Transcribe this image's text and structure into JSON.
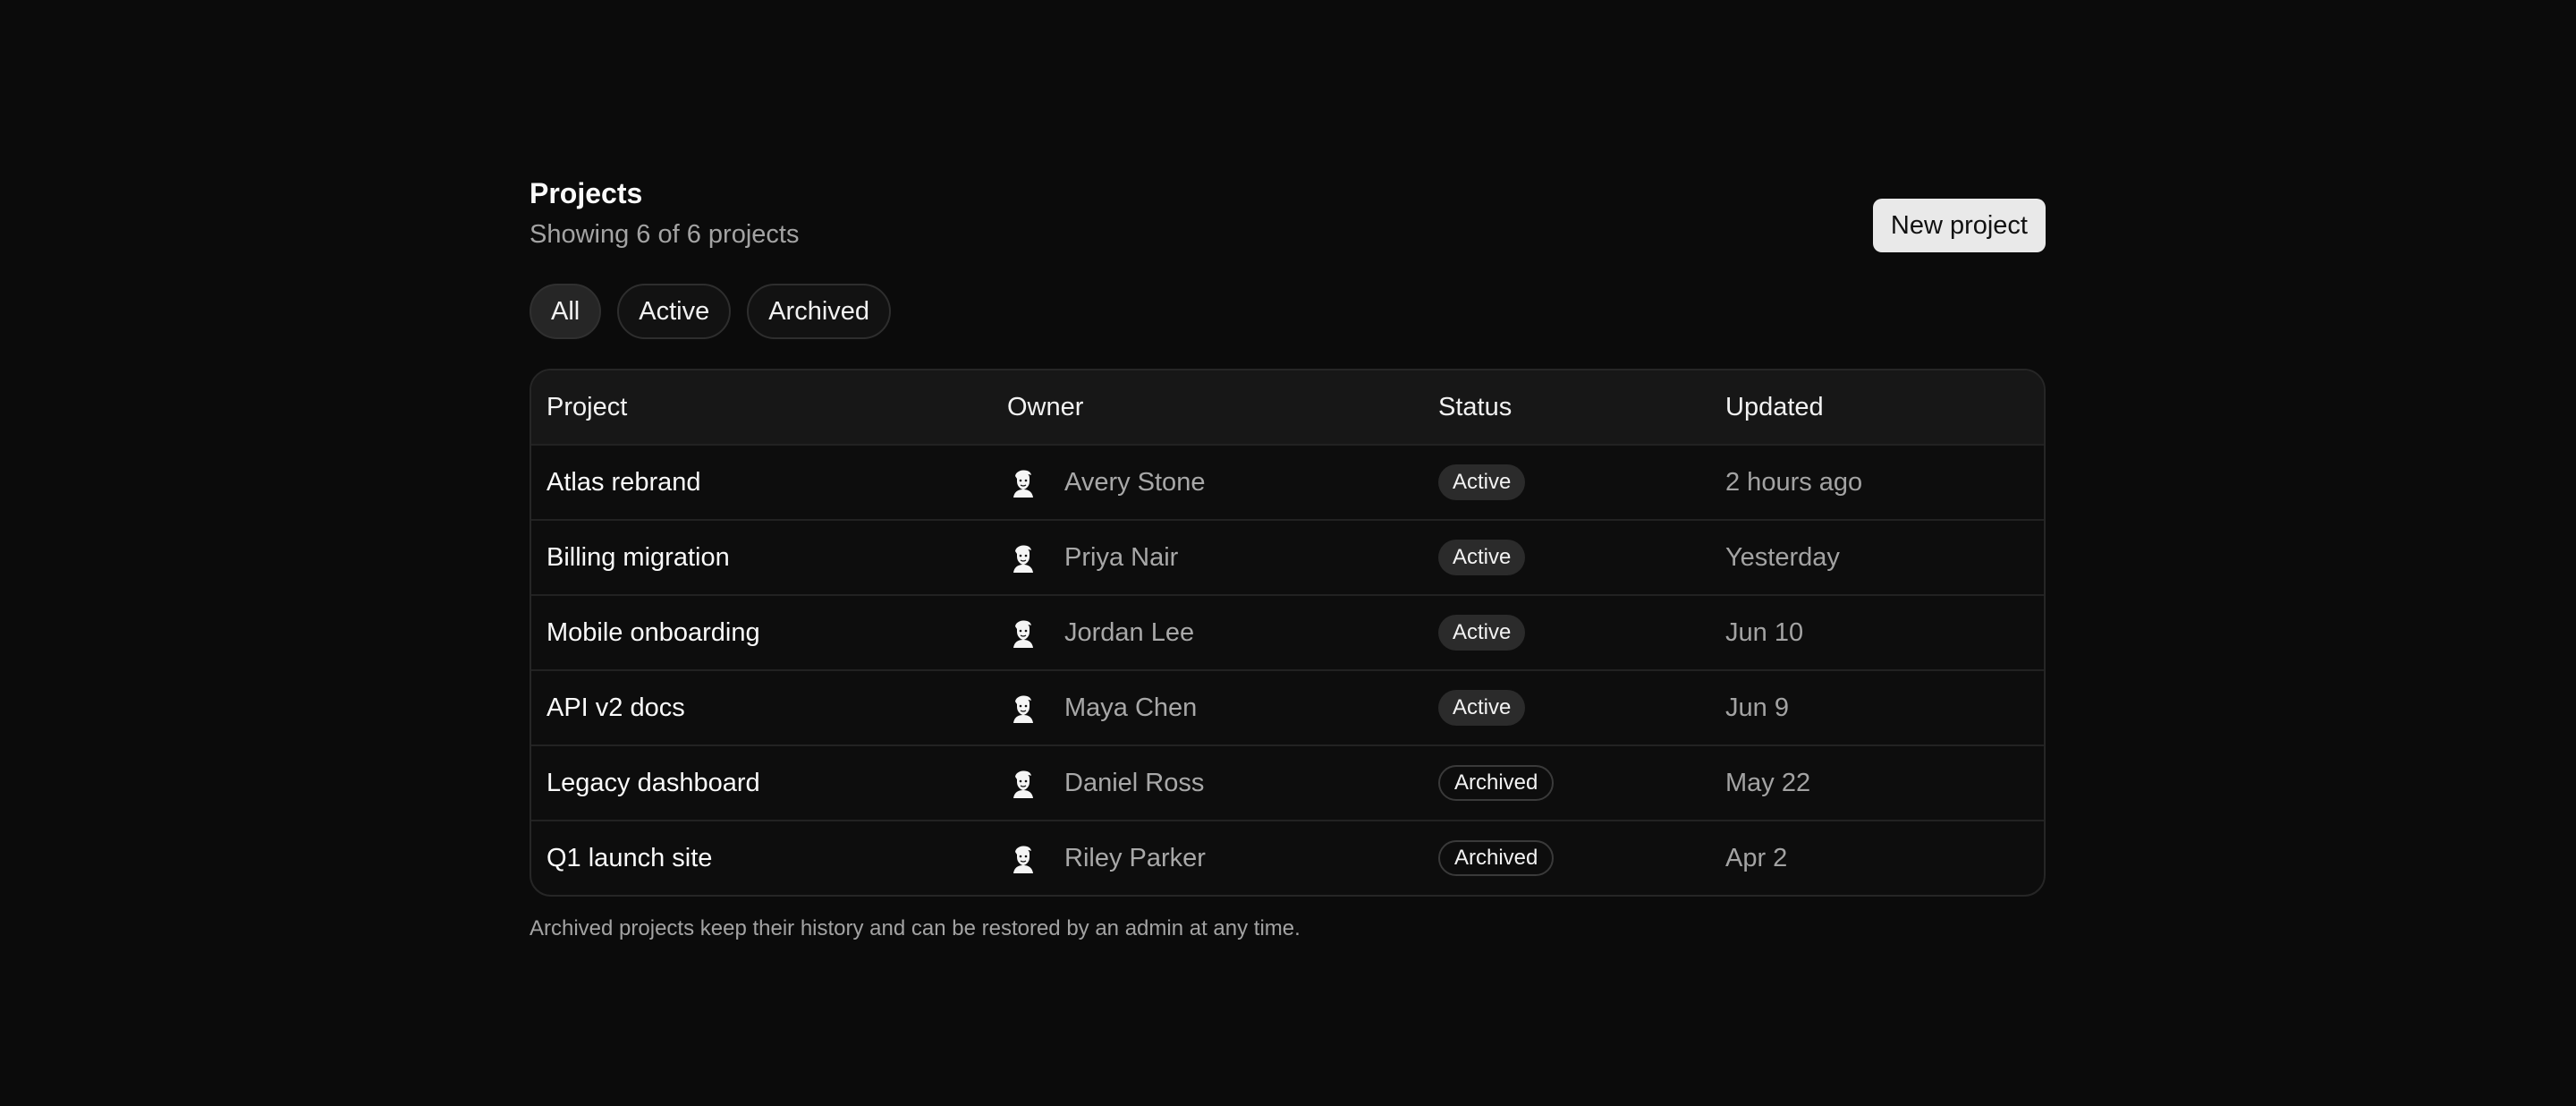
{
  "header": {
    "title": "Projects",
    "subtitle": "Showing 6 of 6 projects",
    "new_button": "New project"
  },
  "filters": [
    {
      "label": "All",
      "selected": true
    },
    {
      "label": "Active",
      "selected": false
    },
    {
      "label": "Archived",
      "selected": false
    }
  ],
  "table": {
    "columns": [
      "Project",
      "Owner",
      "Status",
      "Updated"
    ],
    "rows": [
      {
        "project": "Atlas rebrand",
        "owner": "Avery Stone",
        "status": "Active",
        "updated": "2 hours ago"
      },
      {
        "project": "Billing migration",
        "owner": "Priya Nair",
        "status": "Active",
        "updated": "Yesterday"
      },
      {
        "project": "Mobile onboarding",
        "owner": "Jordan Lee",
        "status": "Active",
        "updated": "Jun 10"
      },
      {
        "project": "API v2 docs",
        "owner": "Maya Chen",
        "status": "Active",
        "updated": "Jun 9"
      },
      {
        "project": "Legacy dashboard",
        "owner": "Daniel Ross",
        "status": "Archived",
        "updated": "May 22"
      },
      {
        "project": "Q1 launch site",
        "owner": "Riley Parker",
        "status": "Archived",
        "updated": "Apr 2"
      }
    ]
  },
  "footnote": "Archived projects keep their history and can be restored by an admin at any time.",
  "icons": {
    "avatar": "avatar-illustration-icon"
  },
  "colors": {
    "background": "#0b0b0b",
    "accent_button": "#e9e9e9"
  }
}
